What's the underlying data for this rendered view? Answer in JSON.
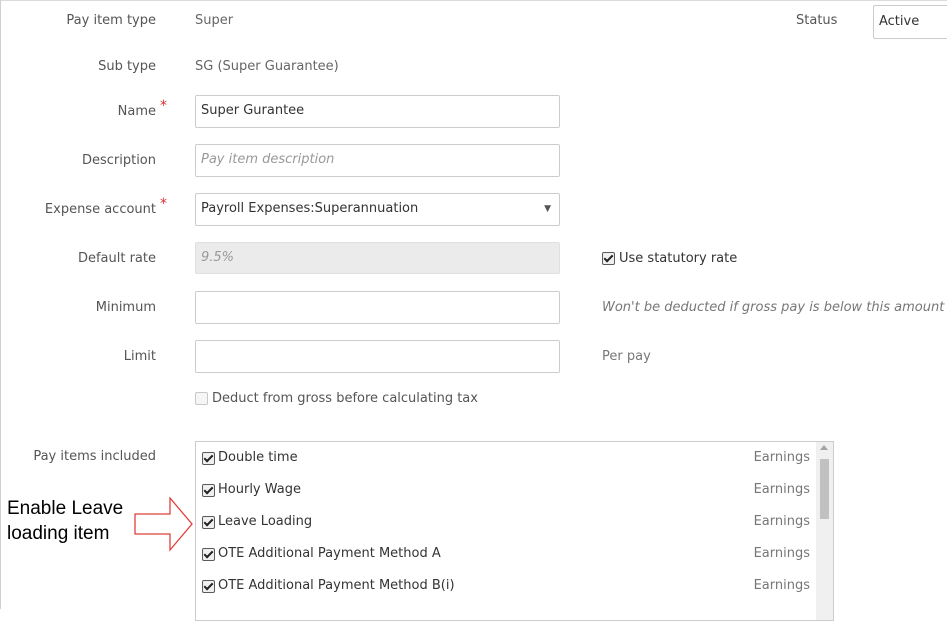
{
  "form": {
    "pay_item_type": {
      "label": "Pay item type",
      "value": "Super"
    },
    "status": {
      "label": "Status",
      "value": "Active"
    },
    "sub_type": {
      "label": "Sub type",
      "value": "SG (Super Guarantee)"
    },
    "name": {
      "label": "Name",
      "required_mark": "*",
      "value": "Super Gurantee"
    },
    "description": {
      "label": "Description",
      "placeholder": "Pay item description"
    },
    "expense_account": {
      "label": "Expense account",
      "required_mark": "*",
      "value": "Payroll Expenses:Superannuation"
    },
    "default_rate": {
      "label": "Default rate",
      "value": "9.5%"
    },
    "use_statutory_rate": {
      "label": "Use statutory rate",
      "checked": true
    },
    "minimum": {
      "label": "Minimum",
      "value": "",
      "note": "Won't be deducted if gross pay is below this amount"
    },
    "limit": {
      "label": "Limit",
      "value": "",
      "note": "Per pay"
    },
    "deduct_from_gross": {
      "label": "Deduct from gross before calculating tax",
      "checked": false
    },
    "pay_items_included": {
      "label": "Pay items included",
      "items": [
        {
          "label": "Double time",
          "type": "Earnings",
          "checked": true
        },
        {
          "label": "Hourly Wage",
          "type": "Earnings",
          "checked": true
        },
        {
          "label": "Leave Loading",
          "type": "Earnings",
          "checked": true
        },
        {
          "label": "OTE Additional Payment Method A",
          "type": "Earnings",
          "checked": true
        },
        {
          "label": "OTE Additional Payment Method B(i)",
          "type": "Earnings",
          "checked": true
        }
      ]
    }
  },
  "annotation": {
    "line1": "Enable Leave",
    "line2": "loading item"
  }
}
